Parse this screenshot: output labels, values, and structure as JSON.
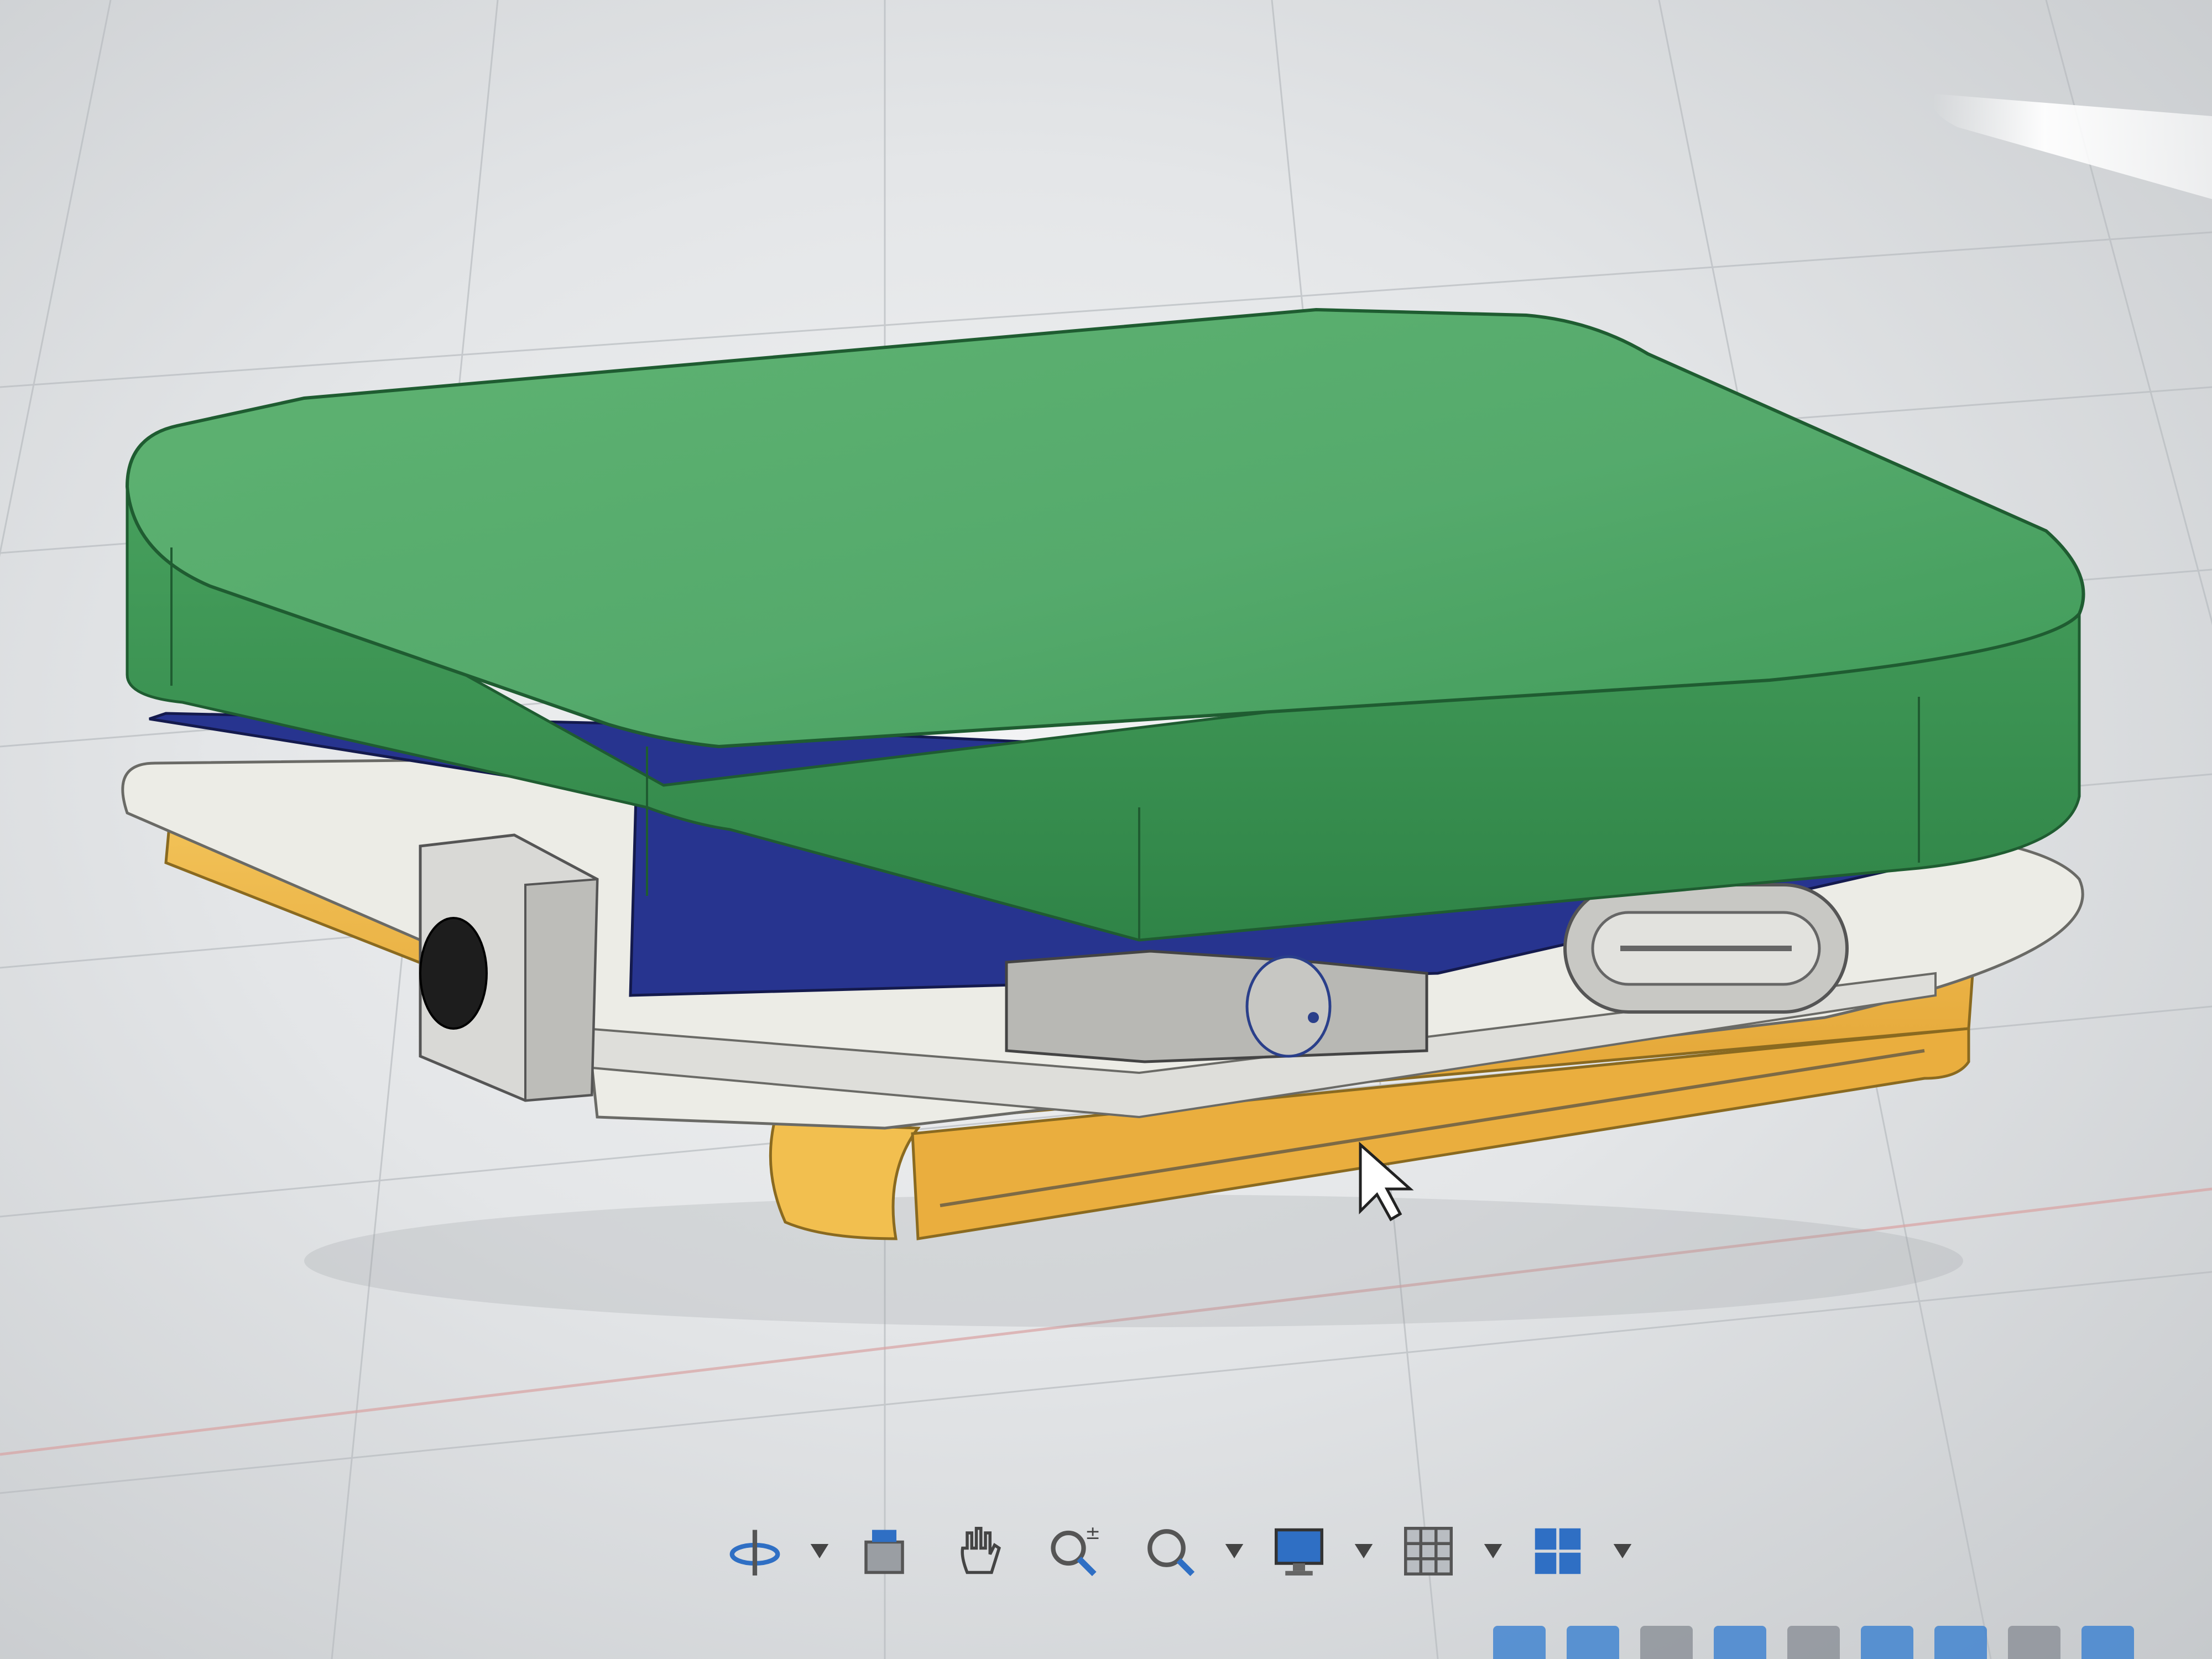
{
  "app": {
    "accent_color": "#2f6fc4"
  },
  "viewport": {
    "model": {
      "lid_color": "#4fa865",
      "board_color": "#27348f",
      "frame_color": "#ecece6",
      "base_color": "#f0b43c",
      "usb_port_icon": "usb-c-port",
      "knob_icon": "rotary-knob"
    },
    "cursor_icon": "mouse-pointer-icon"
  },
  "toolbar": {
    "tools": [
      {
        "name": "orbit",
        "icon": "orbit-icon",
        "has_dropdown": true
      },
      {
        "name": "look-at",
        "icon": "look-at-icon",
        "has_dropdown": false
      },
      {
        "name": "pan",
        "icon": "pan-hand-icon",
        "has_dropdown": false
      },
      {
        "name": "zoom",
        "icon": "zoom-icon",
        "has_dropdown": false
      },
      {
        "name": "fit",
        "icon": "zoom-window-icon",
        "has_dropdown": true
      },
      {
        "name": "display-settings",
        "icon": "display-settings-icon",
        "has_dropdown": true
      },
      {
        "name": "grid-snaps",
        "icon": "grid-icon",
        "has_dropdown": true
      },
      {
        "name": "viewports",
        "icon": "viewports-icon",
        "has_dropdown": true
      }
    ]
  }
}
